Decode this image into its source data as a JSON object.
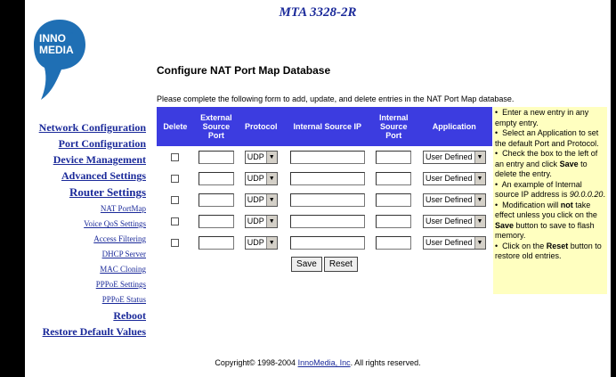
{
  "header": {
    "title": "MTA 3328-2R"
  },
  "logo": {
    "line1": "INNO",
    "line2": "MEDIA",
    "tm": "™"
  },
  "page": {
    "heading": "Configure NAT Port Map Database",
    "instructions": "Please complete the following form to add, update, and delete entries in the NAT Port Map database."
  },
  "nav": {
    "network_configuration": "Network Configuration",
    "port_configuration": "Port Configuration",
    "device_management": "Device Management",
    "advanced_settings": "Advanced Settings",
    "router_settings": "Router Settings",
    "nat_portmap": "NAT PortMap",
    "voice_qos": "Voice QoS Settings",
    "access_filtering": "Access Filtering",
    "dhcp_server": "DHCP Server",
    "mac_cloning": "MAC Cloning",
    "pppoe_settings": "PPPoE Settings",
    "pppoe_status": "PPPoE Status",
    "reboot": "Reboot",
    "restore_defaults": "Restore Default Values"
  },
  "table": {
    "headers": {
      "delete": "Delete",
      "external_port": "External Source Port",
      "protocol": "Protocol",
      "internal_ip": "Internal Source IP",
      "internal_port": "Internal Source Port",
      "application": "Application"
    },
    "rows": [
      {
        "external_port": "",
        "protocol": "UDP",
        "internal_ip": "",
        "internal_port": "",
        "application": "User Defined"
      },
      {
        "external_port": "",
        "protocol": "UDP",
        "internal_ip": "",
        "internal_port": "",
        "application": "User Defined"
      },
      {
        "external_port": "",
        "protocol": "UDP",
        "internal_ip": "",
        "internal_port": "",
        "application": "User Defined"
      },
      {
        "external_port": "",
        "protocol": "UDP",
        "internal_ip": "",
        "internal_port": "",
        "application": "User Defined"
      },
      {
        "external_port": "",
        "protocol": "UDP",
        "internal_ip": "",
        "internal_port": "",
        "application": "User Defined"
      }
    ]
  },
  "buttons": {
    "save": "Save",
    "reset": "Reset"
  },
  "help": {
    "bullet": "•",
    "p1": "Enter a new entry in any empty entry.",
    "p2": "Select an Application to set the default Port and Protocol.",
    "p3_a": "Check the box to the left of an entry and click",
    "p3_b": "Save",
    "p3_c": "to delete the entry.",
    "p4_a": "An example of Internal source IP address is",
    "p4_b": "90.0.0.20",
    "p4_c": ".",
    "p5_a": "Modification will",
    "p5_b": "not",
    "p5_c": "take effect unless you click on the",
    "p5_d": "Save",
    "p5_e": "button to save to flash memory.",
    "p6_a": "Click on the",
    "p6_b": "Reset",
    "p6_c": "button to restore old entries."
  },
  "footer": {
    "pre": "Copyright© 1998-2004",
    "link": "InnoMedia, Inc",
    "post": ". All rights reserved."
  },
  "colors": {
    "header_blue": "#3c3ce0",
    "help_bg": "#ffffc0",
    "link_blue": "#1b2a9a",
    "logo_blue": "#1f6fb4"
  }
}
